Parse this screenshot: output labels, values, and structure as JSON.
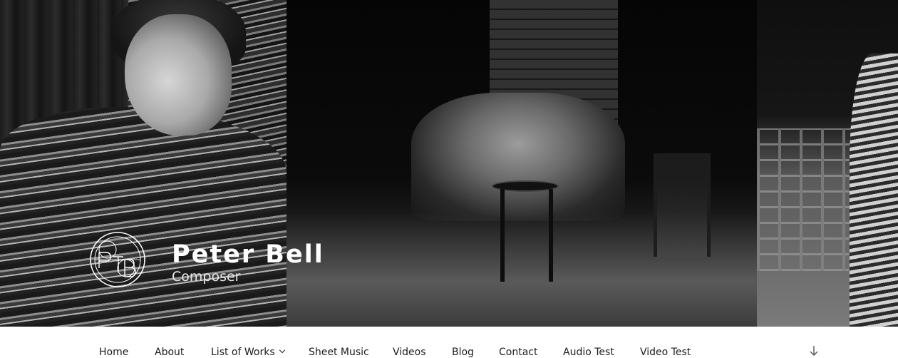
{
  "site": {
    "title": "Peter Bell",
    "tagline": "Composer"
  },
  "nav": {
    "items": [
      {
        "label": "Home"
      },
      {
        "label": "About"
      },
      {
        "label": "List of Works",
        "has_submenu": true
      },
      {
        "label": "Sheet Music"
      },
      {
        "label": "Videos"
      },
      {
        "label": "Blog"
      },
      {
        "label": "Contact"
      },
      {
        "label": "Audio Test"
      },
      {
        "label": "Video Test"
      }
    ],
    "scroll_icon": "arrow-down-icon"
  },
  "header_image": {
    "style": "black and white photo collage",
    "panels": [
      "pianist in patterned sweater",
      "folk band on stage",
      "person in patterned sweater beside stacked chairs"
    ]
  },
  "colors": {
    "nav_background": "#ffffff",
    "nav_text": "#1c1c1c",
    "title_text": "#ffffff"
  }
}
